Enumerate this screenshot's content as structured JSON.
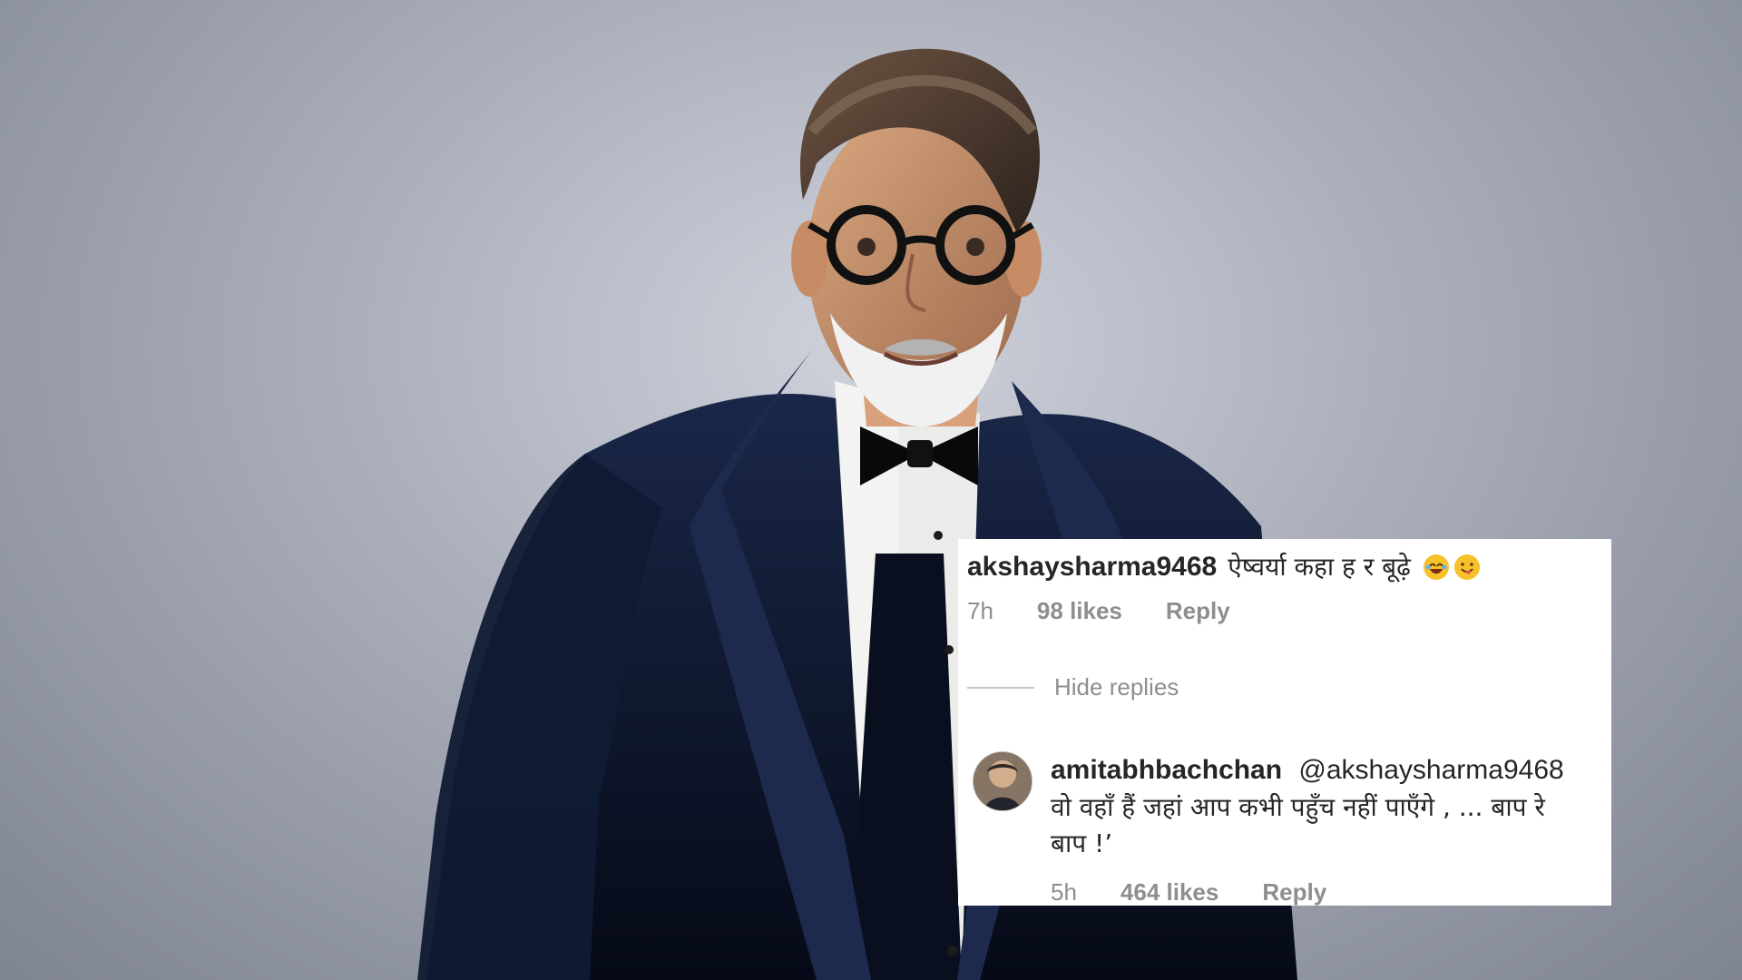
{
  "comment": {
    "username": "akshaysharma9468",
    "text": "ऐष्वर्या कहा ह र बूढ़े",
    "emoji_names": [
      "laughing-face-icon",
      "tongue-face-icon"
    ],
    "time": "7h",
    "likes": "98 likes",
    "reply_label": "Reply"
  },
  "hide_replies_label": "Hide replies",
  "reply": {
    "username": "amitabhbachchan",
    "mention": "@akshaysharma9468",
    "text": "वो वहाँ हैं जहां आप कभी पहुँच नहीं पाएँगे , ... बाप रे बाप !’",
    "time": "5h",
    "likes": "464 likes",
    "reply_label": "Reply"
  },
  "colors": {
    "background": "#a9adb9",
    "card_background": "#ffffff",
    "text_primary": "#262626",
    "text_secondary": "#8e8e8e",
    "suit": "#0d1633"
  }
}
